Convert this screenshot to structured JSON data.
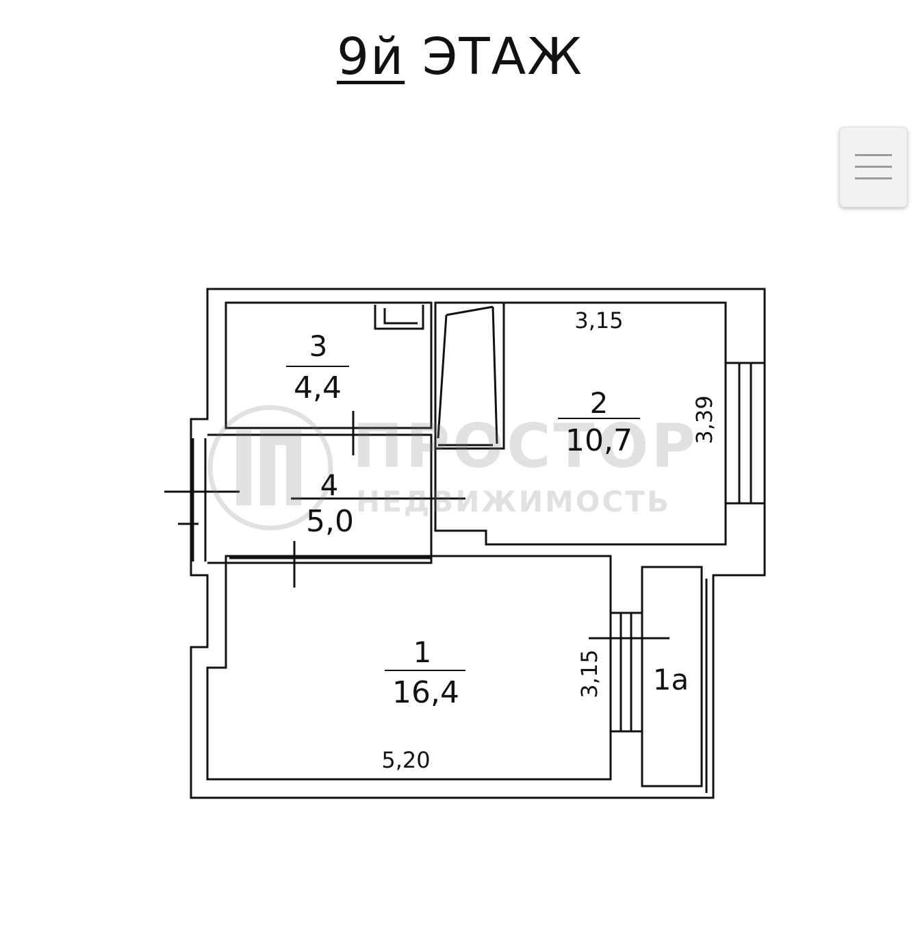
{
  "header": {
    "floor": "9й",
    "label": "ЭТАЖ"
  },
  "menu": {
    "icon": "hamburger-icon"
  },
  "rooms": [
    {
      "number": "1",
      "area": "16,4"
    },
    {
      "number": "2",
      "area": "10,7"
    },
    {
      "number": "3",
      "area": "4,4"
    },
    {
      "number": "4",
      "area": "5,0"
    },
    {
      "number": "1а"
    }
  ],
  "dimensions": {
    "room2_width": "3,15",
    "room2_height": "3,39",
    "room1_width": "5,20",
    "room1_height": "3,15"
  },
  "watermark": {
    "brand": "ПРОСТОР",
    "tagline": "НЕДВИЖИМОСТЬ"
  }
}
